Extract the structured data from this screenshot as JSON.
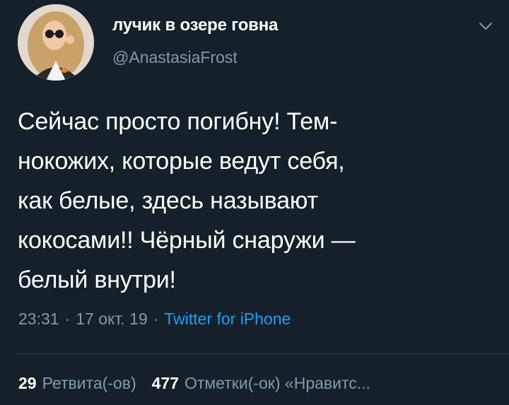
{
  "user": {
    "display_name": "лучик в озере говна",
    "handle": "@AnastasiaFrost",
    "avatar_icon": "profile-photo"
  },
  "menu": {
    "icon": "chevron-down-icon"
  },
  "tweet": {
    "lines": [
      "Сейчас просто погибну! Тем-",
      "нокожих, которые ведут себя,",
      "как белые, здесь называют",
      "кокосами!! Чёрный снаружи —",
      "белый внутри!"
    ]
  },
  "meta": {
    "time": "23:31",
    "separator": "·",
    "date": "17 окт. 19",
    "source": "Twitter for iPhone"
  },
  "stats": {
    "retweets_count": "29",
    "retweets_label": "Ретвита(-ов)",
    "likes_count": "477",
    "likes_label": "Отметки(-ок) «Нравитс..."
  },
  "colors": {
    "background": "#15202b",
    "text": "#ffffff",
    "secondary": "#8899a6",
    "link": "#1da1f2",
    "divider": "#38444d"
  }
}
